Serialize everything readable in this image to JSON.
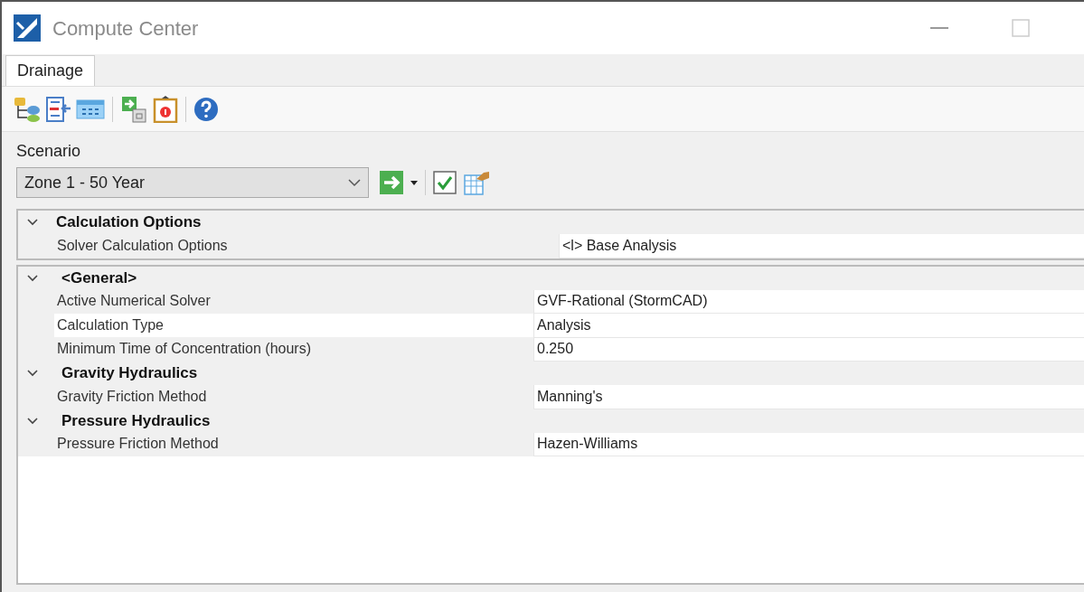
{
  "window": {
    "title": "Compute Center"
  },
  "tabs": [
    {
      "label": "Drainage",
      "selected": true
    }
  ],
  "scenario": {
    "label": "Scenario",
    "value": "Zone 1 - 50 Year"
  },
  "property_grids": [
    {
      "sections": [
        {
          "title": "Calculation Options",
          "expanded": true,
          "rows": [
            {
              "label": "Solver Calculation Options",
              "value": "<l> Base Analysis"
            }
          ]
        }
      ]
    },
    {
      "sections": [
        {
          "title": "<General>",
          "expanded": true,
          "rows": [
            {
              "label": "Active Numerical Solver",
              "value": "GVF-Rational (StormCAD)"
            },
            {
              "label": "Calculation Type",
              "value": "Analysis"
            },
            {
              "label": "Minimum Time of Concentration (hours)",
              "value": "0.250"
            }
          ]
        },
        {
          "title": "Gravity Hydraulics",
          "expanded": true,
          "rows": [
            {
              "label": "Gravity Friction Method",
              "value": "Manning's"
            }
          ]
        },
        {
          "title": "Pressure Hydraulics",
          "expanded": true,
          "rows": [
            {
              "label": "Pressure Friction Method",
              "value": "Hazen-Williams"
            }
          ]
        }
      ]
    }
  ]
}
